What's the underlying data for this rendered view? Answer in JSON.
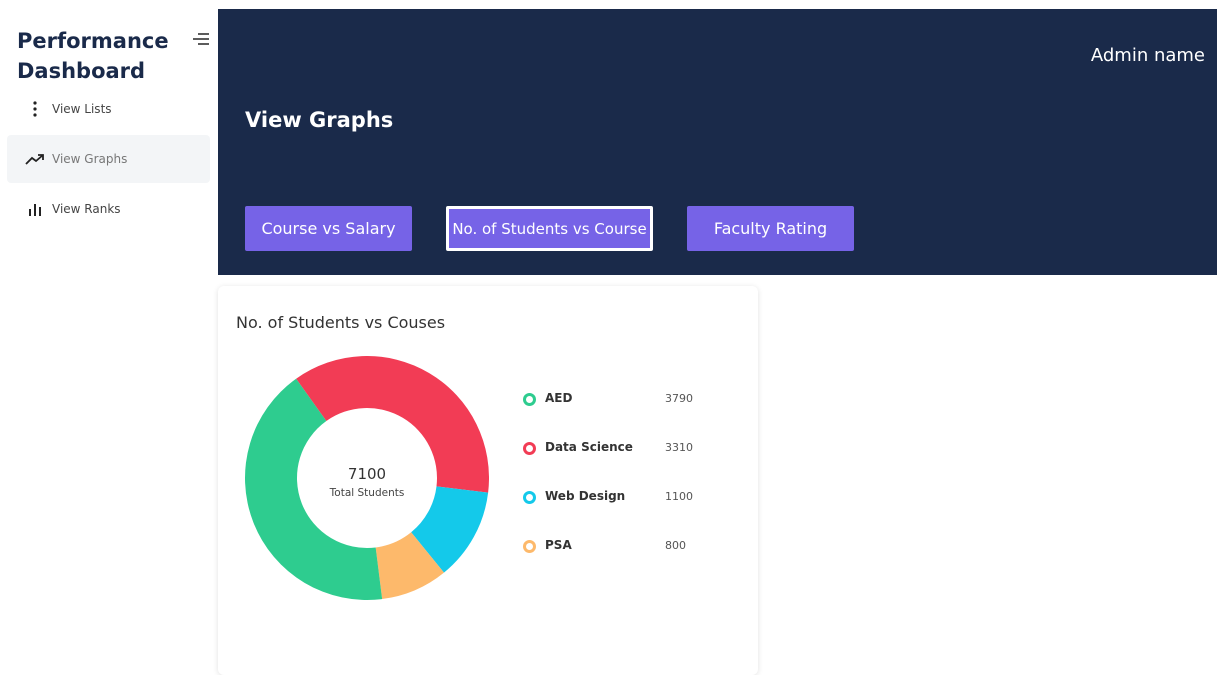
{
  "sidebar": {
    "brand": "Performance Dashboard",
    "items": [
      {
        "label": "View Lists",
        "icon": "vertical-dots-icon"
      },
      {
        "label": "View Graphs",
        "icon": "trending-up-icon"
      },
      {
        "label": "View Ranks",
        "icon": "bar-chart-icon"
      }
    ],
    "active_item": "View Graphs"
  },
  "header": {
    "user": "Admin name",
    "title": "View Graphs",
    "tabs": [
      {
        "label": "Course vs Salary"
      },
      {
        "label": "No. of Students vs Course"
      },
      {
        "label": "Faculty Rating"
      }
    ],
    "selected_tab": "No. of Students vs Course"
  },
  "colors": {
    "header_bg": "#1a2a4a",
    "tab_bg": "#7663e7",
    "aed": "#2ecc8f",
    "data_science": "#f23c55",
    "web_design": "#14c9ea",
    "psa": "#fdb96b"
  },
  "chart_data": {
    "type": "pie",
    "title": "No. of Students vs Couses",
    "center_value": "7100",
    "center_label": "Total Students",
    "categories": [
      "AED",
      "Data Science",
      "Web Design",
      "PSA"
    ],
    "values": [
      3790,
      3310,
      1100,
      800
    ]
  }
}
